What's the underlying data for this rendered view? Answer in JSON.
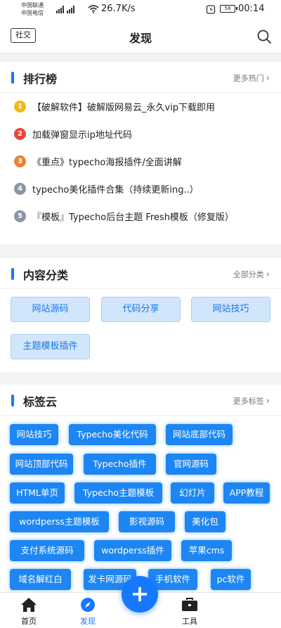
{
  "status_bar": {
    "carrier1": "中国联通",
    "carrier2": "中国电信",
    "net_speed": "26.7K/s",
    "battery": "58",
    "time": "00:14"
  },
  "header": {
    "left_button": "社交",
    "title": "发现",
    "search_icon": "search-icon"
  },
  "ranking": {
    "title": "排行榜",
    "more": "更多热门",
    "items": [
      {
        "num": "1",
        "color": "#f5b914",
        "text": "【破解软件】破解版网易云_永久vip下载即用"
      },
      {
        "num": "2",
        "color": "#e8453c",
        "text": "加载弹窗显示ip地址代码"
      },
      {
        "num": "3",
        "color": "#f0812b",
        "text": "《重点》typecho海报插件/全面讲解"
      },
      {
        "num": "4",
        "color": "#8a96a4",
        "text": "typecho美化插件合集（持续更新ing..）"
      },
      {
        "num": "5",
        "color": "#8a96a4",
        "text": "『模板』Typecho后台主题 Fresh模板（修复版）"
      }
    ]
  },
  "categories": {
    "title": "内容分类",
    "more": "全部分类",
    "items": [
      "网站源码",
      "代码分享",
      "网站技巧",
      "主题模板插件"
    ]
  },
  "tags": {
    "title": "标签云",
    "more": "更多标签",
    "items": [
      "网站技巧",
      "Typecho美化代码",
      "网站底部代码",
      "网站顶部代码",
      "Typecho插件",
      "官网源码",
      "HTML单页",
      "Typecho主题模板",
      "幻灯片",
      "APP教程",
      "wordperss主题模板",
      "影视源码",
      "美化包",
      "支付系统源码",
      "wordperss插件",
      "苹果cms",
      "域名解红白",
      "发卡网源码",
      "手机软件",
      "pc软件"
    ]
  },
  "bottom_nav": {
    "home": "首页",
    "discover": "发现",
    "add": "+",
    "tools": "工具"
  },
  "colors": {
    "accent": "#1677ff",
    "tag_bg": "#1d86f2",
    "category_bg": "#d2e6fb"
  }
}
